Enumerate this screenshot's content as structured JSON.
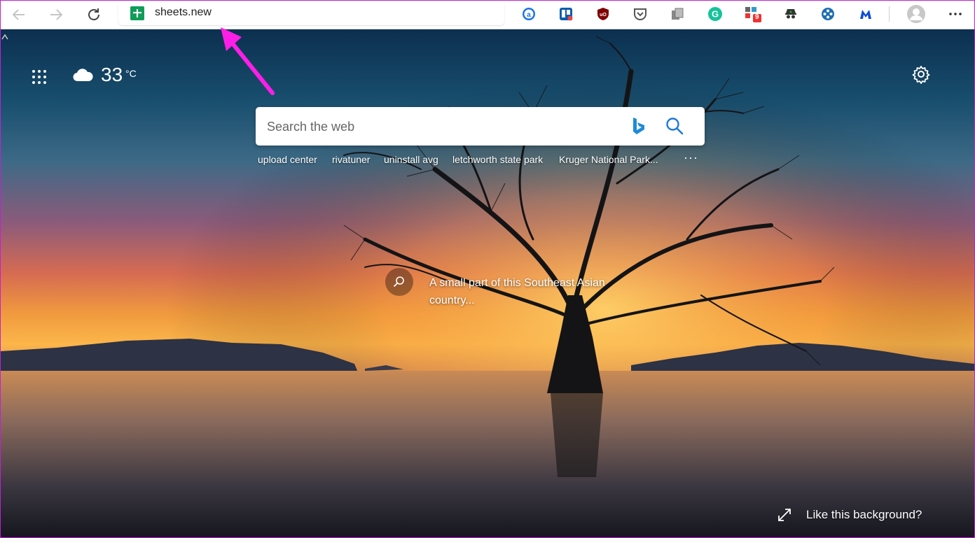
{
  "browser": {
    "address": "sheets.new",
    "extensions": [
      "a-circle-icon",
      "trello-icon",
      "ublock-icon",
      "pocket-icon",
      "copy-icon",
      "grammarly-icon",
      "extension-badge-icon",
      "spy-icon",
      "joystick-icon",
      "malwarebytes-icon"
    ],
    "extension_badge_count": "9"
  },
  "weather": {
    "temperature": "33",
    "unit": "°C"
  },
  "search": {
    "placeholder": "Search the web",
    "trending": [
      "upload center",
      "rivatuner",
      "uninstall avg",
      "letchworth state park",
      "Kruger National Park..."
    ],
    "more": "···"
  },
  "background": {
    "caption": "A small part of this Southeast Asian country...",
    "like_text": "Like this background?"
  },
  "colors": {
    "annotation_arrow": "#ff1ee8",
    "sheets_green": "#0f9d58",
    "bing_blue": "#1d8bd8"
  }
}
